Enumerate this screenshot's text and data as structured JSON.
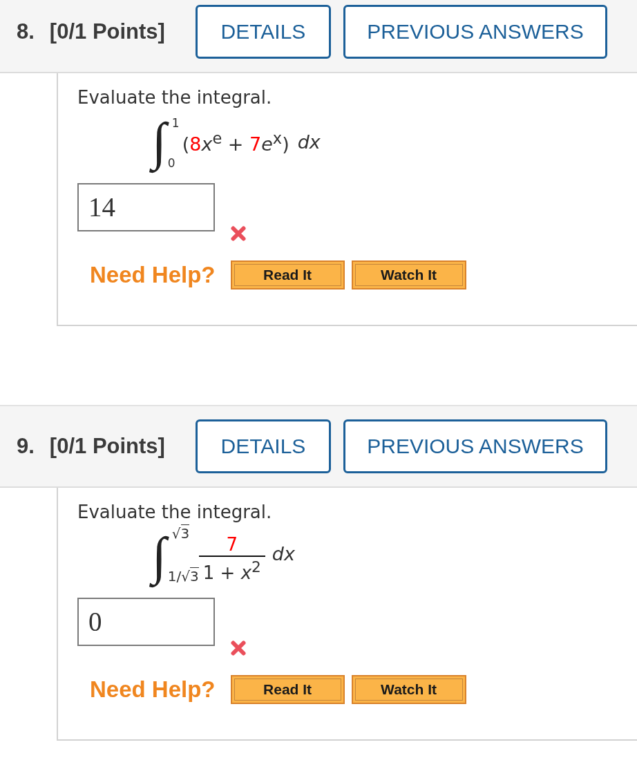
{
  "questions": [
    {
      "number": "8.",
      "points": "[0/1 Points]",
      "buttons": [
        "DETAILS",
        "PREVIOUS ANSWERS"
      ],
      "prompt": "Evaluate the integral.",
      "integral": {
        "kind": "expression",
        "sign": "∫",
        "upper": [
          {
            "kind": "plain",
            "text": "1"
          }
        ],
        "lower": [
          {
            "kind": "plain",
            "text": "0"
          }
        ],
        "integrand": [
          {
            "kind": "plain",
            "text": "("
          },
          {
            "kind": "highlight",
            "text": "8"
          },
          {
            "kind": "plain",
            "text": "*x*$^{e}$ + "
          },
          {
            "kind": "highlight",
            "text": "7"
          },
          {
            "kind": "plain",
            "text": "*e*$^{x}$)"
          }
        ],
        "differential": "dx"
      },
      "answer": {
        "value": "14",
        "correct": false
      },
      "help": {
        "label": "Need Help?",
        "buttons": [
          "Read It",
          "Watch It"
        ]
      }
    },
    {
      "number": "9.",
      "points": "[0/1 Points]",
      "buttons": [
        "DETAILS",
        "PREVIOUS ANSWERS"
      ],
      "prompt": "Evaluate the integral.",
      "integral": {
        "kind": "fraction",
        "sign": "∫",
        "upper": [
          {
            "kind": "plain",
            "text": "√"
          },
          {
            "kind": "overline",
            "text": "3"
          }
        ],
        "lower": [
          {
            "kind": "plain",
            "text": "1/√"
          },
          {
            "kind": "overline",
            "text": "3"
          }
        ],
        "numerator": [
          {
            "kind": "highlight",
            "text": "7"
          }
        ],
        "denominator": [
          {
            "kind": "plain",
            "text": "1 + *x*$^{2}$"
          }
        ],
        "differential": "dx"
      },
      "answer": {
        "value": "0",
        "correct": false
      },
      "help": {
        "label": "Need Help?",
        "buttons": [
          "Read It",
          "Watch It"
        ]
      }
    }
  ]
}
